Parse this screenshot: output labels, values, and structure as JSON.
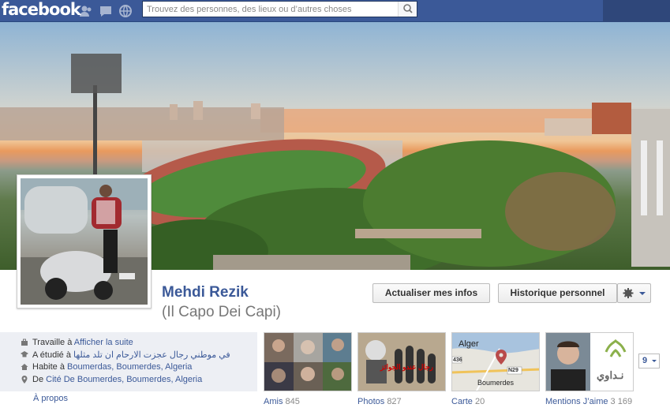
{
  "topbar": {
    "logo": "facebook",
    "search_placeholder": "Trouvez des personnes, des lieux ou d’autres choses",
    "icons": [
      "friends-icon",
      "messages-icon",
      "notifications-icon",
      "search-icon"
    ]
  },
  "profile": {
    "name": "Mehdi Rezik",
    "alternate_name": "(Il Capo Dei Capi)"
  },
  "actions": {
    "update_info": "Actualiser mes infos",
    "activity_log": "Historique personnel"
  },
  "info": {
    "work_prefix": "Travaille à",
    "work_link": "Afficher la suite",
    "study_prefix": "A étudié à",
    "study_link": "في موطني رجال عجزت الارحام ان تلد مثلها",
    "lives_prefix": "Habite à",
    "lives_link": "Boumerdas, Boumerdes, Algeria",
    "from_prefix": "De",
    "from_link": "Cité De Boumerdes, Boumerdes, Algeria",
    "about": "À propos"
  },
  "tiles": [
    {
      "label": "Amis",
      "count": "845"
    },
    {
      "label": "Photos",
      "count": "827"
    },
    {
      "label": "Carte",
      "count": "20"
    },
    {
      "label": "Mentions J’aime",
      "count": "3 169"
    }
  ],
  "map": {
    "city_top": "Alger",
    "city_bottom": "Boumerdes",
    "road": "N29",
    "road2": "436"
  },
  "photo_tile_caption": "رجال عندو الجوائز",
  "likes_tile_brand": "نـداوي",
  "more_count": "9",
  "colors": {
    "brand": "#3b5998",
    "link": "#3b5998",
    "muted": "#777777"
  }
}
